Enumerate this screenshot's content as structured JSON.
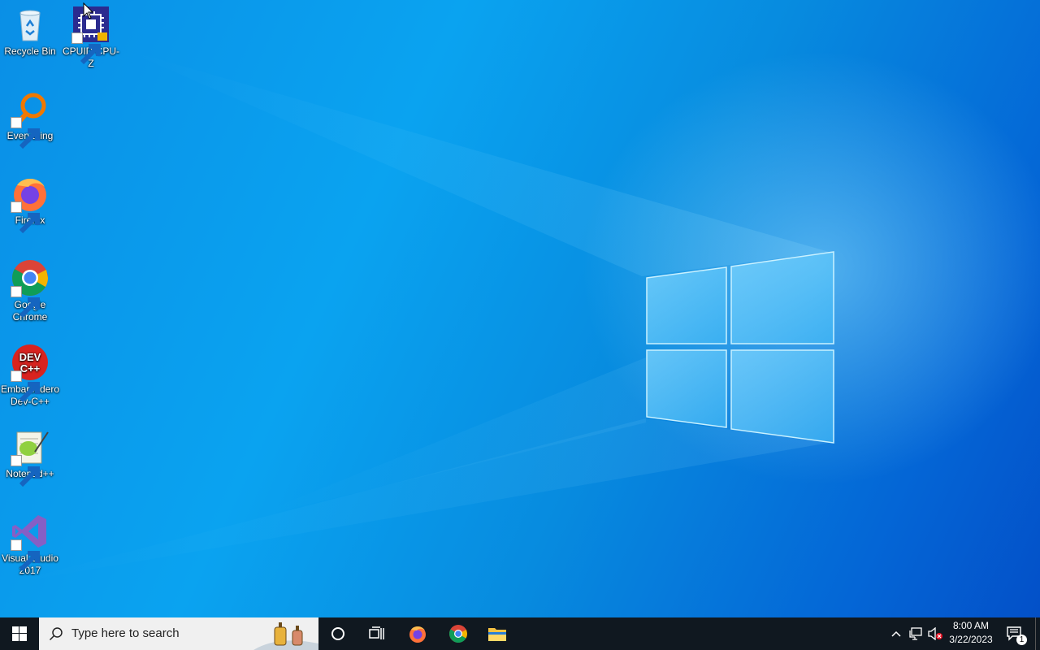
{
  "desktop_icons": [
    {
      "label": "Recycle Bin",
      "icon": "recycle-bin-icon"
    },
    {
      "label": "CPUID CPU-Z",
      "icon": "cpu-z-icon"
    },
    {
      "label": "Everything",
      "icon": "everything-icon"
    },
    {
      "label": "Firefox",
      "icon": "firefox-icon"
    },
    {
      "label": "Google Chrome",
      "icon": "chrome-icon"
    },
    {
      "label": "Embarcadero Dev-C++",
      "icon": "devcpp-icon"
    },
    {
      "label": "Notepad++",
      "icon": "notepadpp-icon"
    },
    {
      "label": "Visual Studio 2017",
      "icon": "visual-studio-icon"
    }
  ],
  "taskbar": {
    "search_placeholder": "Type here to search",
    "pinned": [
      "cortana-icon",
      "task-view-icon",
      "firefox-icon",
      "chrome-icon",
      "file-explorer-icon"
    ],
    "clock": {
      "time": "8:00 AM",
      "date": "3/22/2023"
    },
    "notification_count": "1"
  },
  "colors": {
    "taskbar": "#101820",
    "accent": "#0a8fe6"
  }
}
